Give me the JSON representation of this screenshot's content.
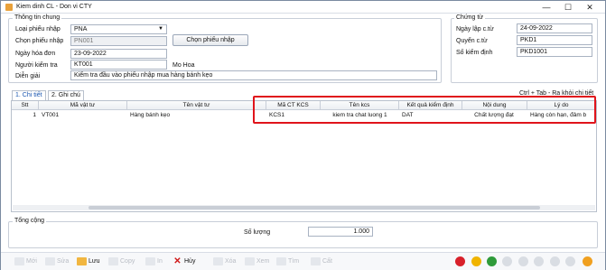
{
  "window": {
    "title": "Kiem dinh CL - Don vi CTY",
    "minimize": "—",
    "maximize": "☐",
    "close": "✕"
  },
  "general": {
    "title": "Thông tin chung",
    "loai_phieu_label": "Loại phiếu nhập",
    "loai_phieu_value": "PNA",
    "chon_phieu_label": "Chọn phiếu nhập",
    "chon_phieu_value": "PN001",
    "chon_phieu_button": "Chọn phiếu nhập",
    "ngay_hoa_don_label": "Ngày hóa đơn",
    "ngay_hoa_don_value": "23-09-2022",
    "nguoi_kiem_tra_label": "Người kiểm tra",
    "nguoi_kiem_tra_value": "KT001",
    "nguoi_kiem_tra_name": "Mo Hoa",
    "dien_giai_label": "Diễn giải",
    "dien_giai_value": "Kiểm tra đầu vào phiếu nhập mua hàng bánh kẹo"
  },
  "voucher": {
    "title": "Chứng từ",
    "ngay_lap_label": "Ngày lập c.từ",
    "ngay_lap_value": "24-09-2022",
    "quyen_label": "Quyển c.từ",
    "quyen_value": "PKD1",
    "so_kiem_dinh_label": "Số kiểm định",
    "so_kiem_dinh_value": "PKD1001"
  },
  "tabs": [
    {
      "label": "1. Chi tiết"
    },
    {
      "label": "2. Ghi chú"
    }
  ],
  "hint": "Ctrl + Tab - Ra khỏi chi tiết",
  "grid": {
    "columns": [
      "Stt",
      "Mã vật tư",
      "Tên vật tư",
      "Mã CT KCS",
      "Tên kcs",
      "Kết quả kiểm định",
      "Nội dung",
      "Lý do"
    ],
    "rows": [
      [
        "1",
        "VT001",
        "Hàng bánh kẹo",
        "KCS1",
        "kiem tra chat luong 1",
        "DAT",
        "Chất lượng đạt",
        "Hàng còn hạn, đảm b"
      ]
    ]
  },
  "summary": {
    "title": "Tổng cộng",
    "so_luong_label": "Số lượng",
    "so_luong_value": "1.000"
  },
  "toolbar": {
    "moi": "Mới",
    "sua": "Sửa",
    "luu": "Lưu",
    "copy": "Copy",
    "in": "In",
    "huy": "Hủy",
    "xoa": "Xóa",
    "xem": "Xem",
    "tim": "Tìm",
    "cat": "Cất"
  },
  "colors": {
    "highlight": "#e0141b",
    "accent": "#1a56b0"
  }
}
